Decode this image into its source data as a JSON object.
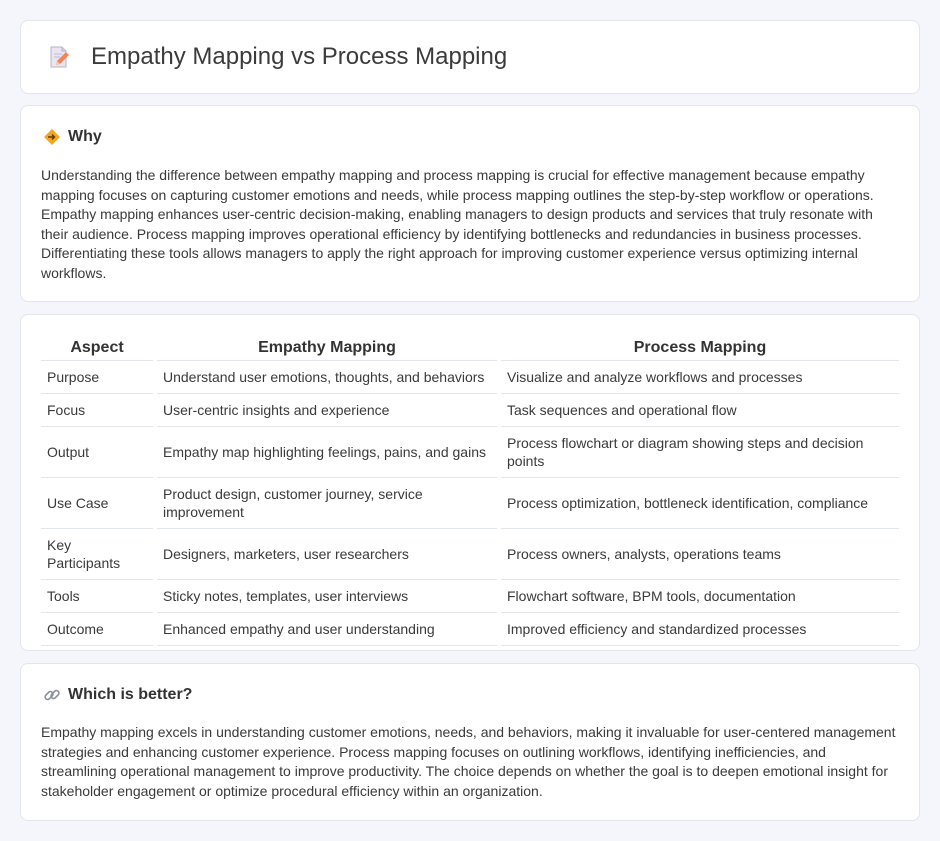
{
  "page": {
    "title": "Empathy Mapping vs Process Mapping"
  },
  "why": {
    "heading": "Why",
    "text": "Understanding the difference between empathy mapping and process mapping is crucial for effective management because empathy mapping focuses on capturing customer emotions and needs, while process mapping outlines the step-by-step workflow or operations. Empathy mapping enhances user-centric decision-making, enabling managers to design products and services that truly resonate with their audience. Process mapping improves operational efficiency by identifying bottlenecks and redundancies in business processes. Differentiating these tools allows managers to apply the right approach for improving customer experience versus optimizing internal workflows."
  },
  "table": {
    "headers": [
      "Aspect",
      "Empathy Mapping",
      "Process Mapping"
    ],
    "rows": [
      [
        "Purpose",
        "Understand user emotions, thoughts, and behaviors",
        "Visualize and analyze workflows and processes"
      ],
      [
        "Focus",
        "User-centric insights and experience",
        "Task sequences and operational flow"
      ],
      [
        "Output",
        "Empathy map highlighting feelings, pains, and gains",
        "Process flowchart or diagram showing steps and decision points"
      ],
      [
        "Use Case",
        "Product design, customer journey, service improvement",
        "Process optimization, bottleneck identification, compliance"
      ],
      [
        "Key Participants",
        "Designers, marketers, user researchers",
        "Process owners, analysts, operations teams"
      ],
      [
        "Tools",
        "Sticky notes, templates, user interviews",
        "Flowchart software, BPM tools, documentation"
      ],
      [
        "Outcome",
        "Enhanced empathy and user understanding",
        "Improved efficiency and standardized processes"
      ]
    ]
  },
  "better": {
    "heading": "Which is better?",
    "text": "Empathy mapping excels in understanding customer emotions, needs, and behaviors, making it invaluable for user-centered management strategies and enhancing customer experience. Process mapping focuses on outlining workflows, identifying inefficiencies, and streamlining operational management to improve productivity. The choice depends on whether the goal is to deepen emotional insight for stakeholder engagement or optimize procedural efficiency within an organization."
  },
  "icons": {
    "title": "document-pencil-icon",
    "why": "diamond-arrows-icon",
    "better": "link-icon"
  }
}
